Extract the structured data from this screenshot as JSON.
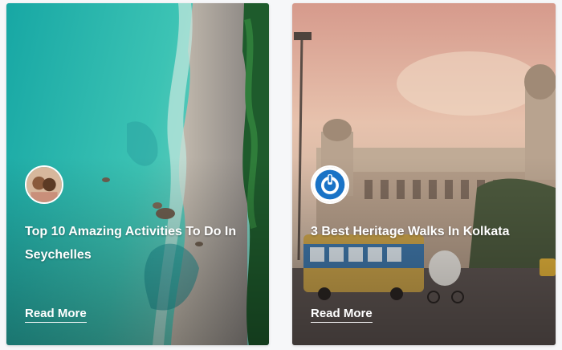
{
  "cards": [
    {
      "title": "Top 10 Amazing Activities To Do In Seychelles",
      "read_more": "Read More",
      "author_avatar": "author-photo-avatar"
    },
    {
      "title": "3 Best Heritage Walks In Kolkata",
      "read_more": "Read More",
      "author_avatar": "power-logo-avatar"
    }
  ],
  "colors": {
    "text": "#ffffff",
    "avatar_blue": "#1a73c6",
    "sea": "#1fb5b0",
    "sky": "#e3b8a6"
  }
}
